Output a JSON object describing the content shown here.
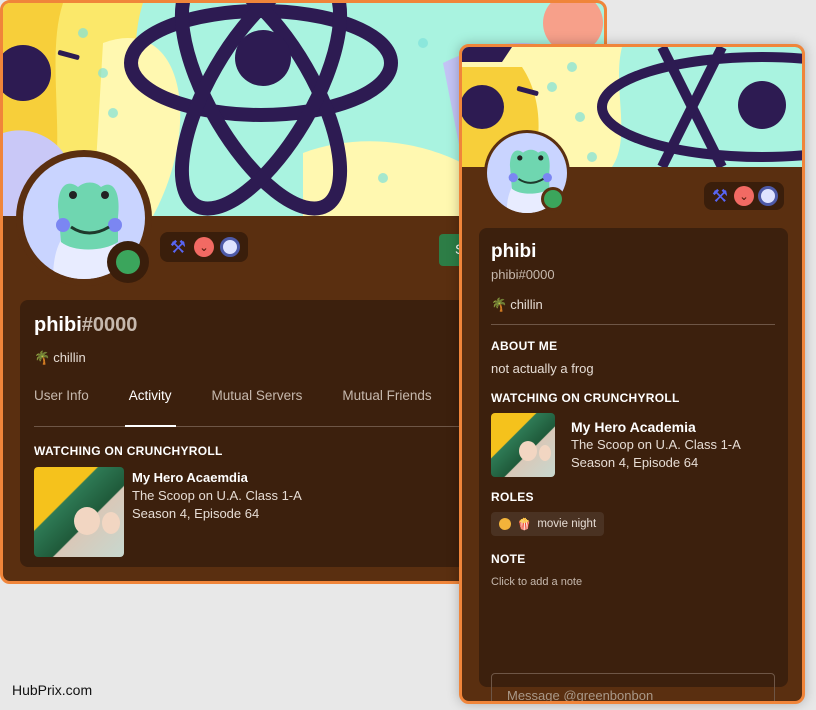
{
  "colors": {
    "accent_border": "#f0853a",
    "card_bg": "#5a2f10",
    "inner_bg": "#3c200d",
    "status_online": "#3ba55c",
    "send_button": "#2d7d46",
    "role_dot": "#f3b33a"
  },
  "full_profile": {
    "username": "phibi",
    "discriminator": "#0000",
    "custom_status": {
      "emoji": "palm-tree-icon",
      "text": "chillin"
    },
    "badges": [
      "hypesquad-icon",
      "server-boost-icon",
      "nitro-icon"
    ],
    "send_button_label": "Send Message",
    "tabs": [
      {
        "label": "User Info",
        "active": false
      },
      {
        "label": "Activity",
        "active": true
      },
      {
        "label": "Mutual Servers",
        "active": false
      },
      {
        "label": "Mutual Friends",
        "active": false
      }
    ],
    "activity": {
      "heading": "WATCHING ON CRUNCHYROLL",
      "title": "My Hero Acaemdia",
      "line1": "The Scoop on U.A. Class 1-A",
      "line2": "Season 4, Episode 64"
    }
  },
  "popout": {
    "display_name": "phibi",
    "tag": "phibi#0000",
    "custom_status": {
      "emoji": "palm-tree-icon",
      "text": "chillin"
    },
    "badges": [
      "hypesquad-icon",
      "server-boost-icon",
      "nitro-icon"
    ],
    "about_heading": "ABOUT ME",
    "about_text": "not actually a frog",
    "activity": {
      "heading": "WATCHING ON CRUNCHYROLL",
      "title": "My Hero Academia",
      "line1": "The Scoop on U.A. Class 1-A",
      "line2": "Season 4, Episode 64"
    },
    "roles_heading": "ROLES",
    "roles": [
      {
        "emoji": "🍿",
        "name": "movie night"
      }
    ],
    "note_heading": "NOTE",
    "note_placeholder": "Click to add a note",
    "message_placeholder": "Message @greenbonbon"
  },
  "watermark": "HubPrix.com"
}
